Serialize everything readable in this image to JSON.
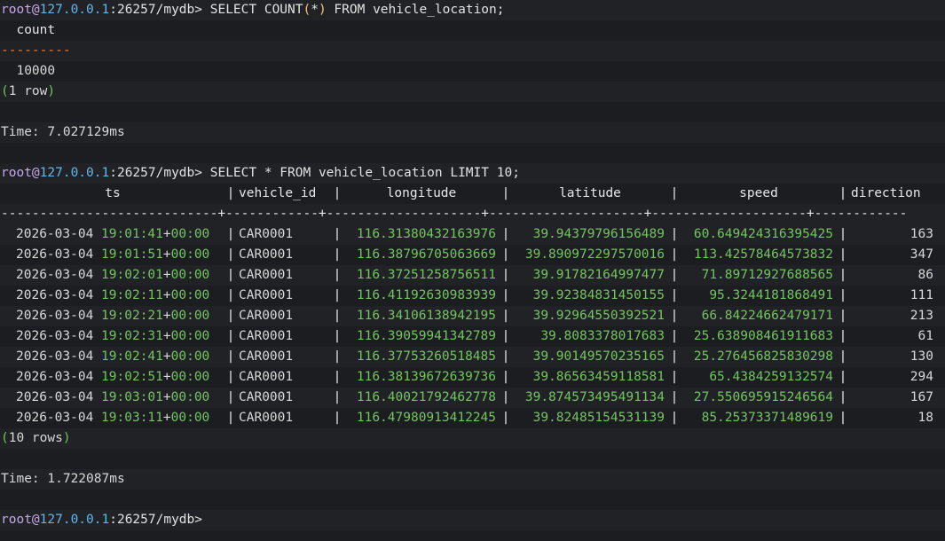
{
  "prompt": {
    "user": "root",
    "at": "@",
    "host": "127.0.0.1",
    "port_db": ":26257/mydb>"
  },
  "query1": {
    "sql_before": " SELECT COUNT",
    "paren_open": "(",
    "star": "*",
    "paren_close": ")",
    "sql_after": " FROM vehicle_location;",
    "header": "count",
    "separator": "---------",
    "value": "10000",
    "rows_open": "(",
    "rows_text": "1 row",
    "rows_close": ")",
    "time": "Time: 7.027129ms"
  },
  "query2": {
    "sql": " SELECT * FROM vehicle_location LIMIT 10;",
    "columns": [
      "ts",
      "vehicle_id",
      "longitude",
      "latitude",
      "speed",
      "direction"
    ],
    "separator": "----------------------------+------------+--------------------+--------------------+--------------------+------------",
    "rows": [
      {
        "date": "2026-03-04",
        "time": "19:01:41",
        "tz": "+00:00",
        "vehicle_id": "CAR0001",
        "longitude": "116.31380432163976",
        "latitude": "39.94379796156489",
        "speed": "60.649424316395425",
        "direction": "163"
      },
      {
        "date": "2026-03-04",
        "time": "19:01:51",
        "tz": "+00:00",
        "vehicle_id": "CAR0001",
        "longitude": "116.38796705063669",
        "latitude": "39.890972297570016",
        "speed": "113.42578464573832",
        "direction": "347"
      },
      {
        "date": "2026-03-04",
        "time": "19:02:01",
        "tz": "+00:00",
        "vehicle_id": "CAR0001",
        "longitude": "116.37251258756511",
        "latitude": "39.91782164997477",
        "speed": "71.89712927688565",
        "direction": "86"
      },
      {
        "date": "2026-03-04",
        "time": "19:02:11",
        "tz": "+00:00",
        "vehicle_id": "CAR0001",
        "longitude": "116.41192630983939",
        "latitude": "39.92384831450155",
        "speed": "95.3244181868491",
        "direction": "111"
      },
      {
        "date": "2026-03-04",
        "time": "19:02:21",
        "tz": "+00:00",
        "vehicle_id": "CAR0001",
        "longitude": "116.34106138942195",
        "latitude": "39.92964550392521",
        "speed": "66.84224662479171",
        "direction": "213"
      },
      {
        "date": "2026-03-04",
        "time": "19:02:31",
        "tz": "+00:00",
        "vehicle_id": "CAR0001",
        "longitude": "116.39059941342789",
        "latitude": "39.8083378017683",
        "speed": "25.638908461911683",
        "direction": "61"
      },
      {
        "date": "2026-03-04",
        "time": "19:02:41",
        "tz": "+00:00",
        "vehicle_id": "CAR0001",
        "longitude": "116.37753260518485",
        "latitude": "39.90149570235165",
        "speed": "25.276456825830298",
        "direction": "130"
      },
      {
        "date": "2026-03-04",
        "time": "19:02:51",
        "tz": "+00:00",
        "vehicle_id": "CAR0001",
        "longitude": "116.38139672639736",
        "latitude": "39.86563459118581",
        "speed": "65.4384259132574",
        "direction": "294"
      },
      {
        "date": "2026-03-04",
        "time": "19:03:01",
        "tz": "+00:00",
        "vehicle_id": "CAR0001",
        "longitude": "116.40021792462778",
        "latitude": "39.874573495491134",
        "speed": "27.550695915246564",
        "direction": "167"
      },
      {
        "date": "2026-03-04",
        "time": "19:03:11",
        "tz": "+00:00",
        "vehicle_id": "CAR0001",
        "longitude": "116.47980913412245",
        "latitude": "39.82485154531139",
        "speed": "85.25373371489619",
        "direction": "18"
      }
    ],
    "rows_open": "(",
    "rows_text": "10 rows",
    "rows_close": ")",
    "time": "Time: 1.722087ms"
  },
  "colors": {
    "background": "#1b1d20",
    "user": "#c6a8e8",
    "host": "#62b6ea",
    "number_green": "#74c462",
    "separator_orange": "#e8813a"
  }
}
